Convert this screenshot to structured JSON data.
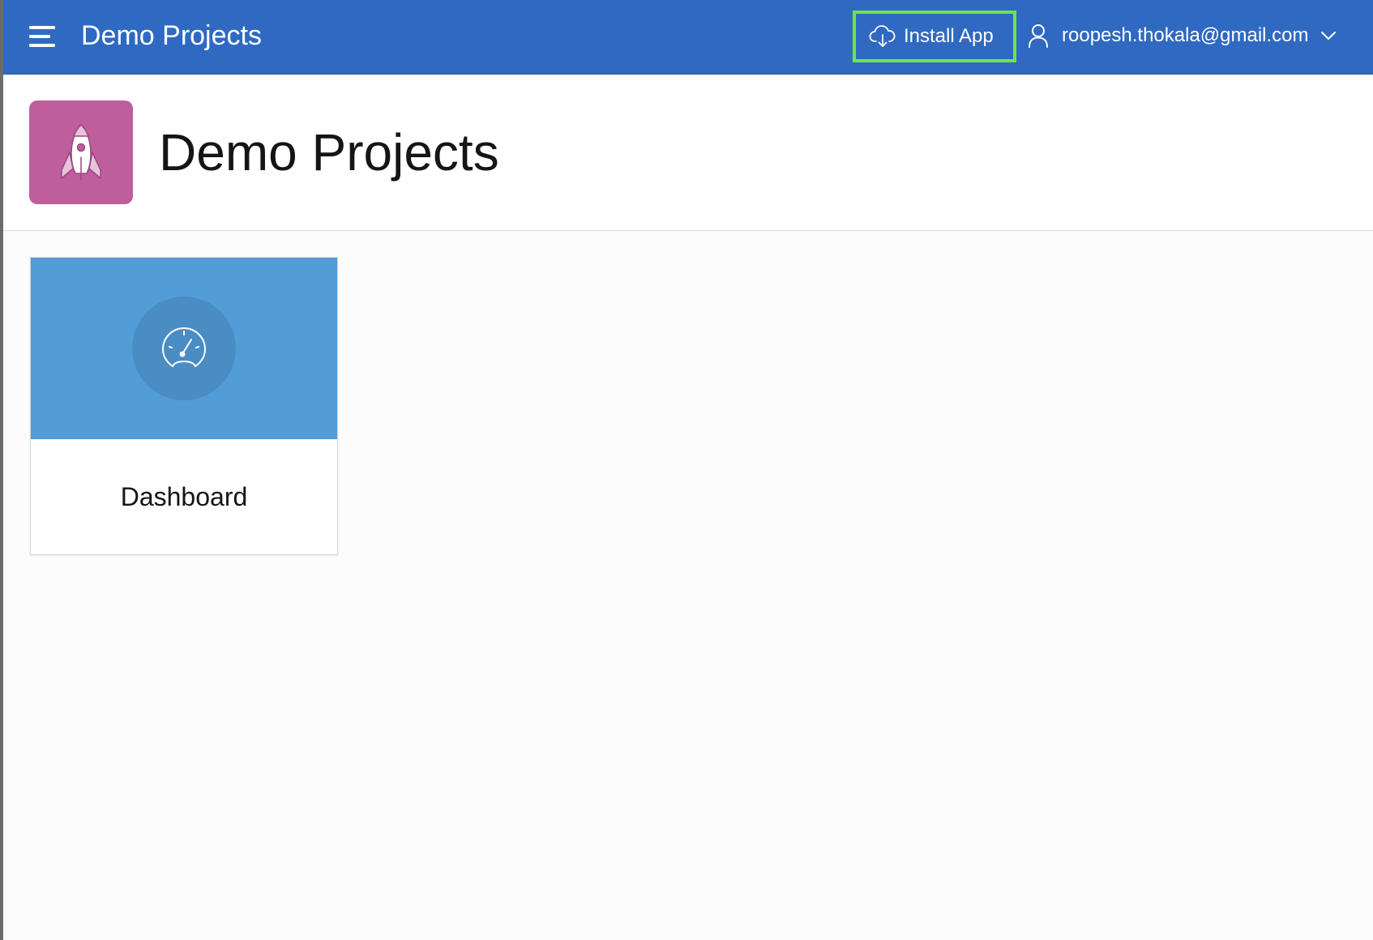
{
  "header": {
    "app_title": "Demo Projects",
    "menu_icon": "hamburger-menu-icon",
    "install_label": "Install App",
    "install_icon": "cloud-download-icon",
    "user_email": "roopesh.thokala@gmail.com",
    "user_icon": "user-icon",
    "user_dropdown_icon": "chevron-down-icon",
    "background_color": "#2f69c2",
    "highlight_color": "#6fe44a"
  },
  "hero": {
    "title": "Demo Projects",
    "icon": "rocket-icon",
    "icon_background": "#be5e9d"
  },
  "cards": [
    {
      "label": "Dashboard",
      "icon": "speedometer-icon",
      "top_color": "#529cd8"
    }
  ]
}
